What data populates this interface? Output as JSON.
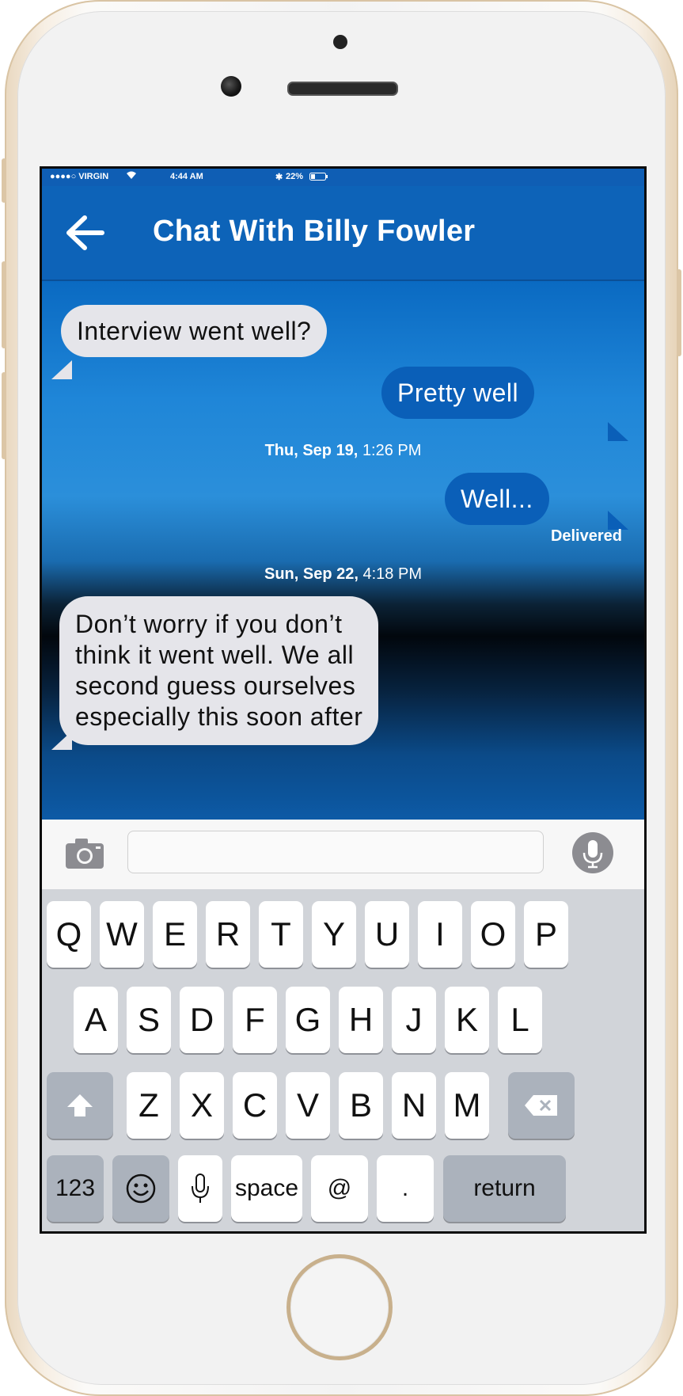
{
  "status_bar": {
    "carrier": "●●●●○ VIRGIN",
    "time": "4:44 AM",
    "battery": "22%"
  },
  "header": {
    "back_icon": "←",
    "title": "Chat With Billy Fowler"
  },
  "messages": [
    {
      "direction": "in",
      "text": "Interview went well?"
    },
    {
      "direction": "out",
      "text": "Pretty well"
    },
    {
      "type": "timestamp",
      "day": "Thu, Sep 19,",
      "time": "1:26 PM"
    },
    {
      "direction": "out",
      "text": "Well...",
      "status": "Delivered"
    },
    {
      "type": "timestamp",
      "day": "Sun, Sep 22,",
      "time": "4:18 PM"
    },
    {
      "direction": "in",
      "lines": [
        "Don’t worry if you don’t",
        "think it went well. We all",
        "second guess ourselves",
        "especially this soon after"
      ]
    }
  ],
  "input_bar": {
    "placeholder": "",
    "value": ""
  },
  "keyboard": {
    "row1": [
      "Q",
      "W",
      "E",
      "R",
      "T",
      "Y",
      "U",
      "I",
      "O",
      "P"
    ],
    "row2": [
      "A",
      "S",
      "D",
      "F",
      "G",
      "H",
      "J",
      "K",
      "L"
    ],
    "row3": [
      "Z",
      "X",
      "C",
      "V",
      "B",
      "N",
      "M"
    ],
    "numbers_label": "123",
    "space_label": "space",
    "at_label": "@",
    "period_label": ".",
    "return_label": "return"
  },
  "colors": {
    "header_blue": "#0d63b8",
    "outgoing_bubble": "#0a5fb8",
    "incoming_bubble": "#e5e5ea"
  }
}
